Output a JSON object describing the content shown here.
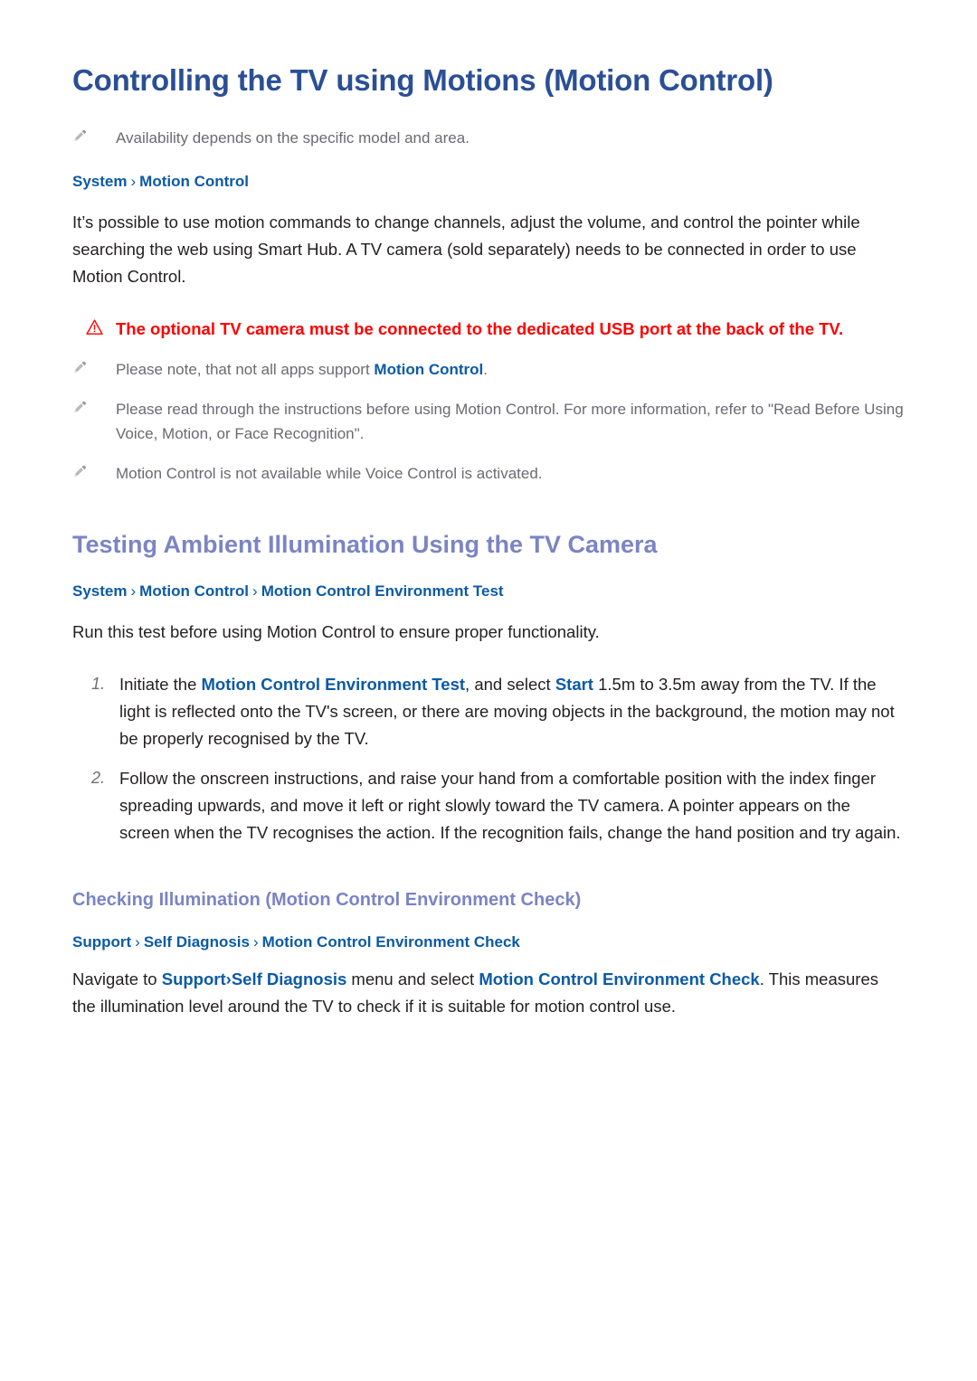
{
  "document": {
    "title": "Controlling the TV using Motions (Motion Control)",
    "note_intro": "Availability depends on the specific model and area.",
    "path_1": {
      "part_1": "System",
      "sep": "›",
      "part_2": "Motion Control"
    },
    "intro_paragraph": "It’s possible to use motion commands to change channels, adjust the volume, and control the pointer while searching the web using Smart Hub. A TV camera (sold separately) needs to be connected in order to use Motion Control.",
    "caution": "The optional TV camera must be connected to the dedicated USB port at the back of the TV.",
    "notes": [
      {
        "text_before": "Please note, that not all apps support ",
        "link": "Motion Control",
        "text_after": "."
      },
      {
        "text_before": "Please read through the instructions before using Motion Control. For more information, refer to \"Read Before Using Voice, Motion, or Face Recognition\".",
        "link": "",
        "text_after": ""
      },
      {
        "text_before": "Motion Control is not available while Voice Control is activated.",
        "link": "",
        "text_after": ""
      }
    ],
    "section_2": {
      "heading": "Testing Ambient Illumination Using the TV Camera",
      "path": {
        "part_1": "System",
        "sep_1": "›",
        "part_2": "Motion Control",
        "sep_2": "›",
        "part_3": "Motion Control Environment Test"
      },
      "intro": "Run this test before using Motion Control to ensure proper functionality.",
      "steps": [
        {
          "number": "1.",
          "seg_1": "Initiate the ",
          "link_1": "Motion Control Environment Test",
          "seg_2": ", and select ",
          "link_2": "Start",
          "seg_3": " 1.5m to 3.5m away from the TV. If the light is reflected onto the TV's screen, or there are moving objects in the background, the motion may not be properly recognised by the TV."
        },
        {
          "number": "2.",
          "seg_1": "Follow the onscreen instructions, and raise your hand from a comfortable position with the index finger spreading upwards, and move it left or right slowly toward the TV camera. A pointer appears on the screen when the TV recognises the action. If the recognition fails, change the hand position and try again.",
          "link_1": "",
          "seg_2": "",
          "link_2": "",
          "seg_3": ""
        }
      ]
    },
    "section_3": {
      "heading": "Checking Illumination (Motion Control Environment Check)",
      "path": {
        "part_1": "Support",
        "sep_1": "›",
        "part_2": "Self Diagnosis",
        "sep_2": "›",
        "part_3": "Motion Control Environment Check"
      },
      "seg_1": "Navigate to ",
      "link_1": "Support",
      "seg_sep": "›",
      "link_2": "Self Diagnosis",
      "seg_2": " menu and select ",
      "link_3": "Motion Control Environment Check",
      "seg_3": ". This measures the illumination level around the TV to check if it is suitable for motion control use."
    }
  },
  "colors": {
    "title_blue": "#2a4f96",
    "heading_periwinkle": "#7b84c4",
    "link_blue": "#0b5aa6",
    "caution_red": "#ff0000",
    "note_gray": "#6a6a72",
    "body_black": "#231f20",
    "icon_gray": "#9b9b9b"
  },
  "icons": {
    "note": "pencil-icon",
    "caution": "warning-triangle-icon"
  }
}
